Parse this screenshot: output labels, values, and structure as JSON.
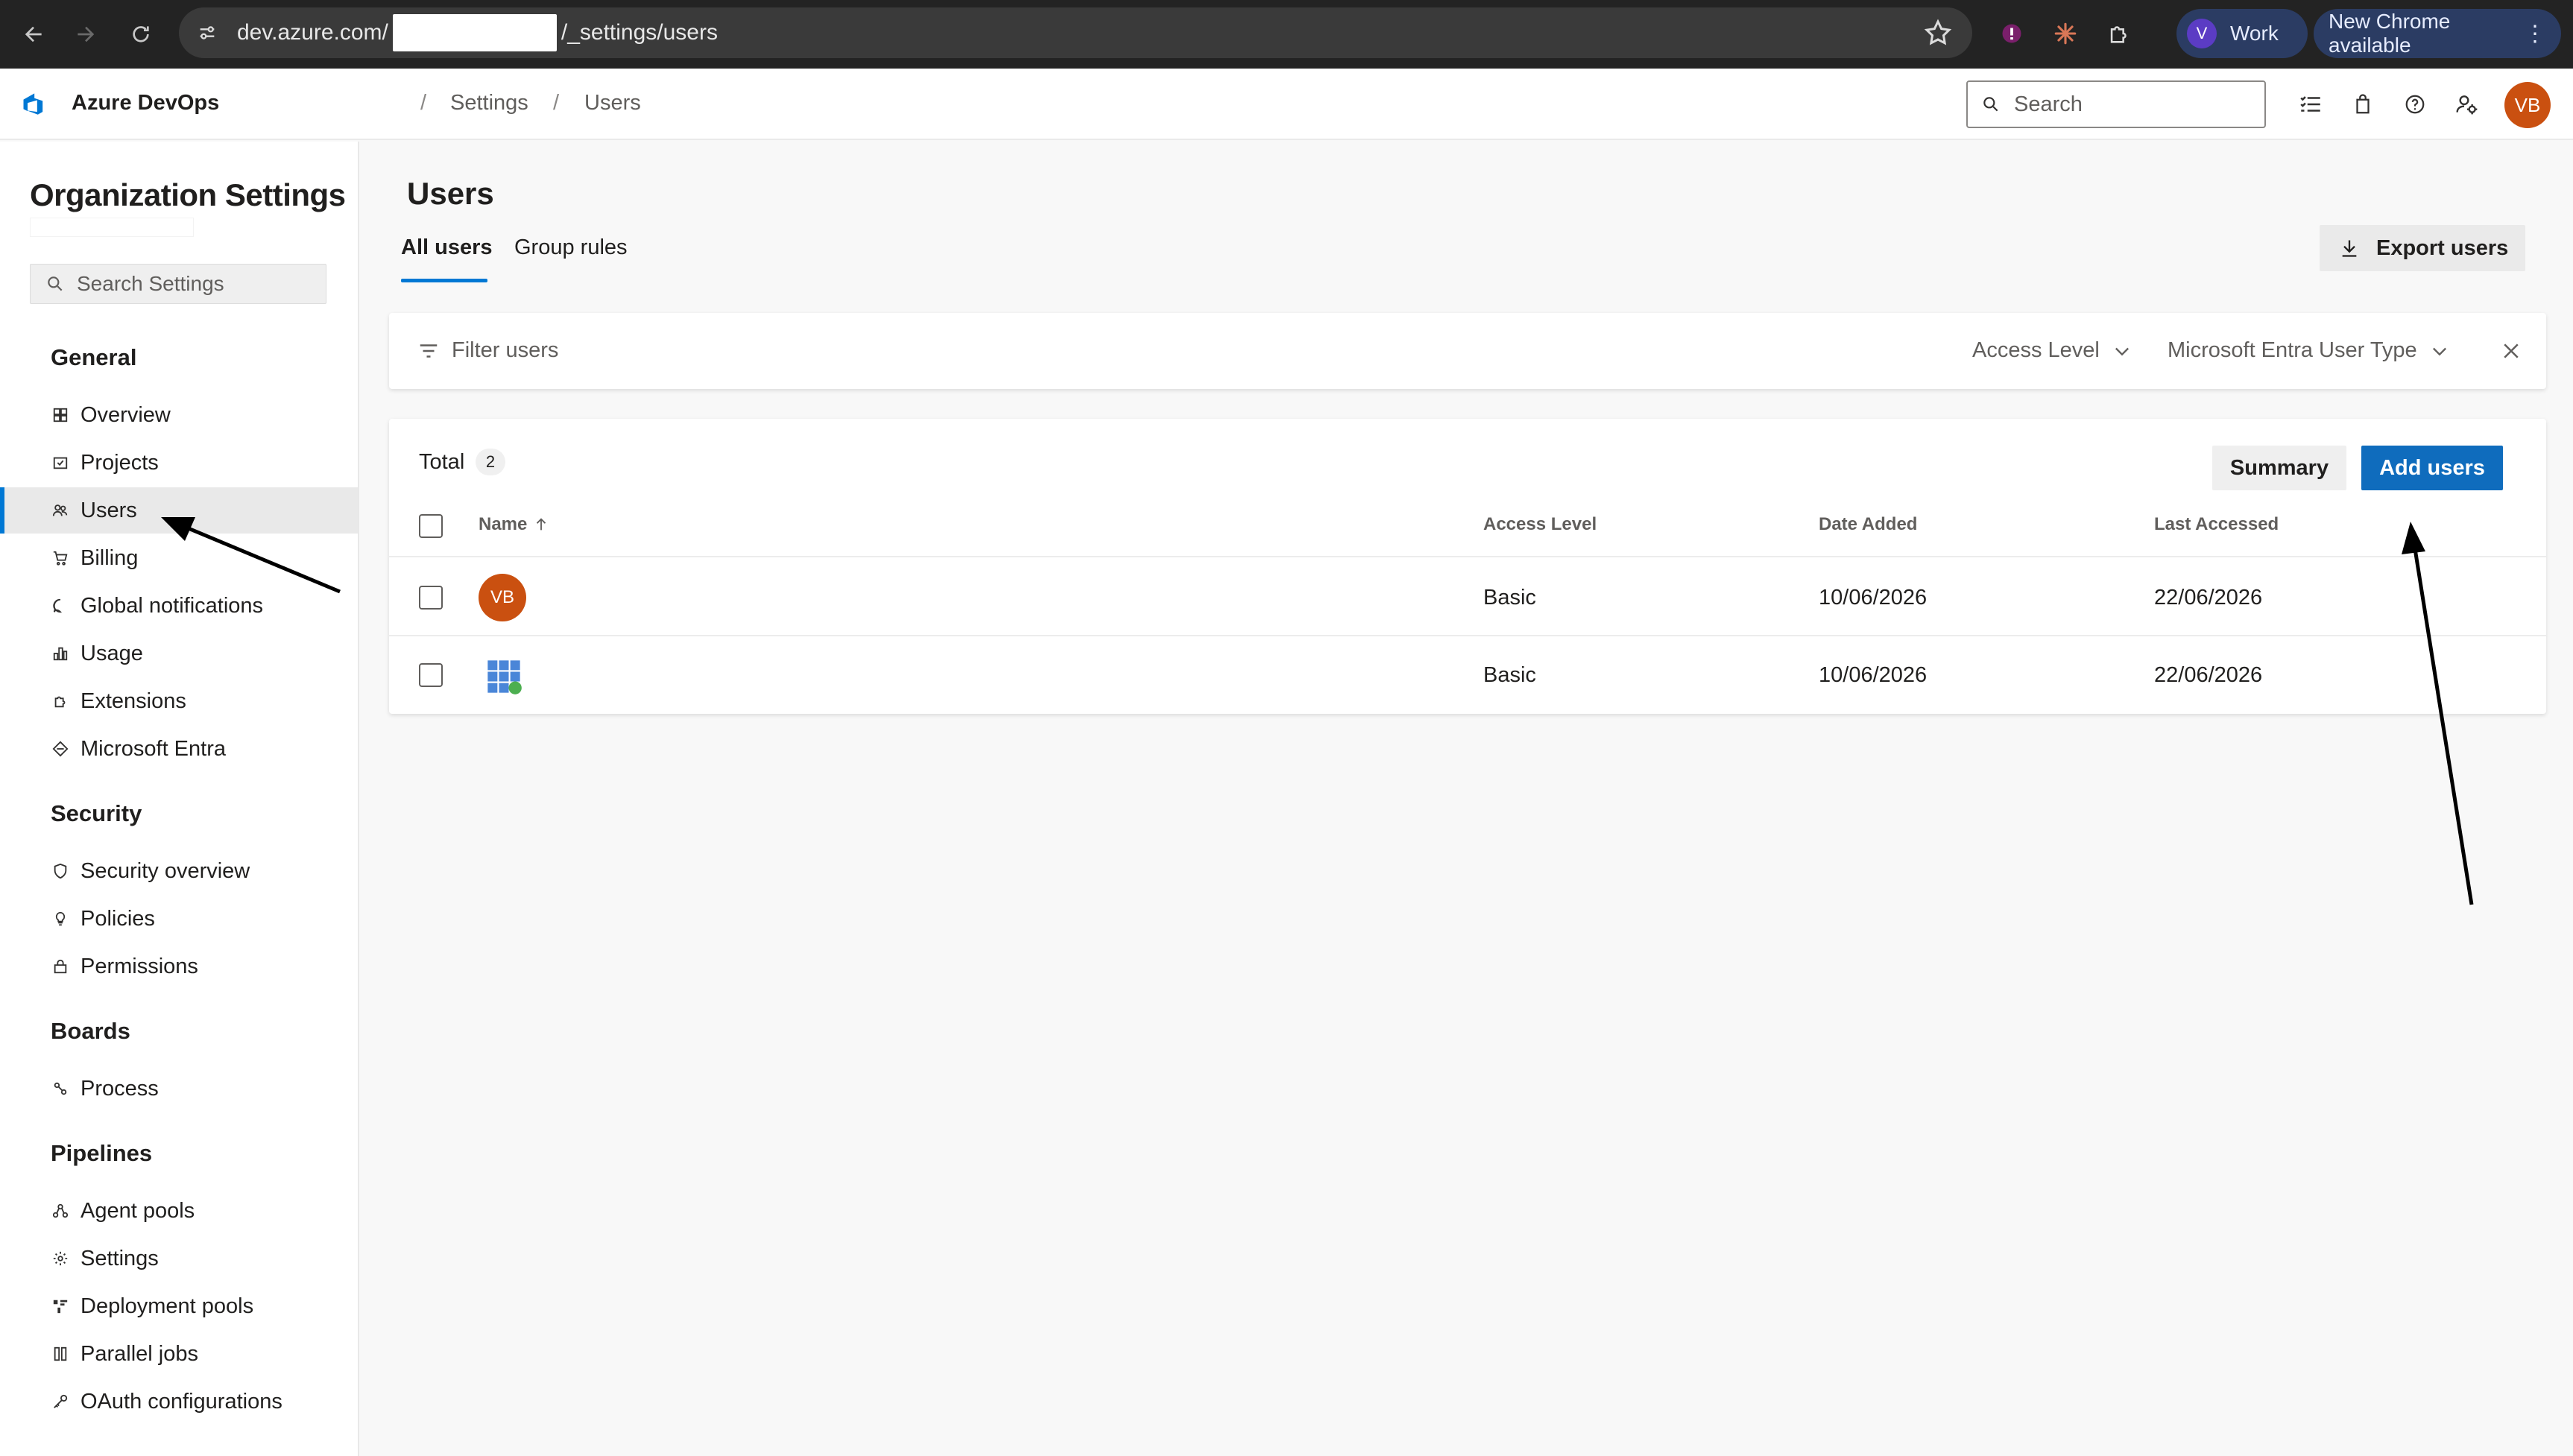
{
  "browser": {
    "url_prefix": "dev.azure.com/",
    "url_suffix": "/_settings/users",
    "profile_initial": "V",
    "profile_label": "Work",
    "update_label": "New Chrome available"
  },
  "header": {
    "product": "Azure DevOps",
    "breadcrumbs": [
      "Settings",
      "Users"
    ],
    "separator": "/",
    "search_placeholder": "Search",
    "user_initials": "VB"
  },
  "sidebar": {
    "title": "Organization Settings",
    "search_placeholder": "Search Settings",
    "sections": [
      {
        "heading": "General",
        "items": [
          {
            "label": "Overview",
            "icon": "overview-icon"
          },
          {
            "label": "Projects",
            "icon": "projects-icon"
          },
          {
            "label": "Users",
            "icon": "users-icon",
            "active": true
          },
          {
            "label": "Billing",
            "icon": "cart-icon"
          },
          {
            "label": "Global notifications",
            "icon": "chat-icon"
          },
          {
            "label": "Usage",
            "icon": "chart-icon"
          },
          {
            "label": "Extensions",
            "icon": "extensions-icon"
          },
          {
            "label": "Microsoft Entra",
            "icon": "entra-icon"
          }
        ]
      },
      {
        "heading": "Security",
        "items": [
          {
            "label": "Security overview",
            "icon": "shield-icon"
          },
          {
            "label": "Policies",
            "icon": "lightbulb-icon"
          },
          {
            "label": "Permissions",
            "icon": "lock-icon"
          }
        ]
      },
      {
        "heading": "Boards",
        "items": [
          {
            "label": "Process",
            "icon": "process-icon"
          }
        ]
      },
      {
        "heading": "Pipelines",
        "items": [
          {
            "label": "Agent pools",
            "icon": "agent-pools-icon"
          },
          {
            "label": "Settings",
            "icon": "gear-icon"
          },
          {
            "label": "Deployment pools",
            "icon": "deployment-icon"
          },
          {
            "label": "Parallel jobs",
            "icon": "parallel-icon"
          },
          {
            "label": "OAuth configurations",
            "icon": "key-icon"
          }
        ]
      }
    ]
  },
  "main": {
    "title": "Users",
    "tabs": [
      {
        "label": "All users",
        "active": true
      },
      {
        "label": "Group rules"
      }
    ],
    "export_label": "Export users",
    "filter_placeholder": "Filter users",
    "filter_access_level": "Access Level",
    "filter_user_type": "Microsoft Entra User Type",
    "total_label": "Total",
    "total_count": "2",
    "summary_label": "Summary",
    "add_users_label": "Add users",
    "columns": {
      "name": "Name",
      "access_level": "Access Level",
      "date_added": "Date Added",
      "last_accessed": "Last Accessed"
    },
    "rows": [
      {
        "avatar": "VB",
        "access_level": "Basic",
        "date_added": "10/06/2026",
        "last_accessed": "22/06/2026"
      },
      {
        "avatar": "grid-avatar",
        "access_level": "Basic",
        "date_added": "10/06/2026",
        "last_accessed": "22/06/2026"
      }
    ]
  },
  "colors": {
    "accent": "#0078d4",
    "primary_button": "#0f6cbd",
    "avatar": "#ca5010",
    "chrome": "#232323"
  }
}
